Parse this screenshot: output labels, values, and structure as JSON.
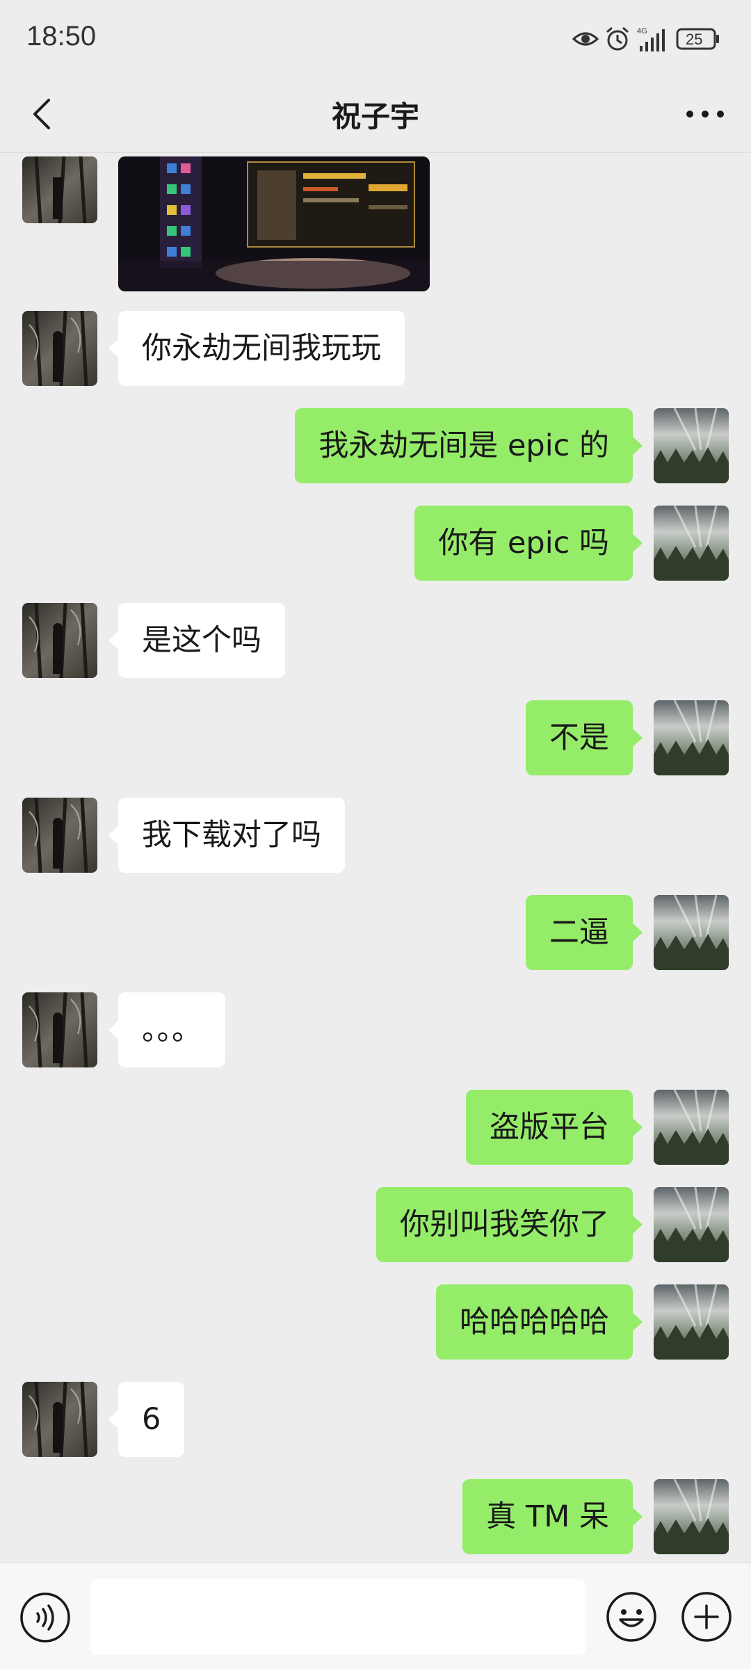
{
  "status_bar": {
    "time": "18:50",
    "battery": "25",
    "icons": [
      "eye-icon",
      "alarm-icon",
      "4g-signal-icon",
      "battery-icon"
    ]
  },
  "header": {
    "title": "祝子宇",
    "back_icon": "chevron-left-icon",
    "more_icon": "more-dots-icon"
  },
  "messages": [
    {
      "side": "left",
      "type": "image"
    },
    {
      "side": "left",
      "text": "你永劫无间我玩玩"
    },
    {
      "side": "right",
      "text": "我永劫无间是 epic 的"
    },
    {
      "side": "right",
      "text": "你有 epic 吗"
    },
    {
      "side": "left",
      "text": "是这个吗"
    },
    {
      "side": "right",
      "text": "不是"
    },
    {
      "side": "left",
      "text": "我下载对了吗"
    },
    {
      "side": "right",
      "text": "二逼"
    },
    {
      "side": "left",
      "text": "。。。"
    },
    {
      "side": "right",
      "text": "盗版平台"
    },
    {
      "side": "right",
      "text": "你别叫我笑你了"
    },
    {
      "side": "right",
      "text": "哈哈哈哈哈"
    },
    {
      "side": "left",
      "text": "6"
    },
    {
      "side": "right",
      "text": "真 TM 呆"
    }
  ],
  "input_bar": {
    "input_value": "",
    "icons": [
      "voice-icon",
      "emoji-icon",
      "plus-icon"
    ]
  },
  "colors": {
    "background": "#ededed",
    "bubble_self": "#95ec69",
    "bubble_other": "#ffffff"
  }
}
